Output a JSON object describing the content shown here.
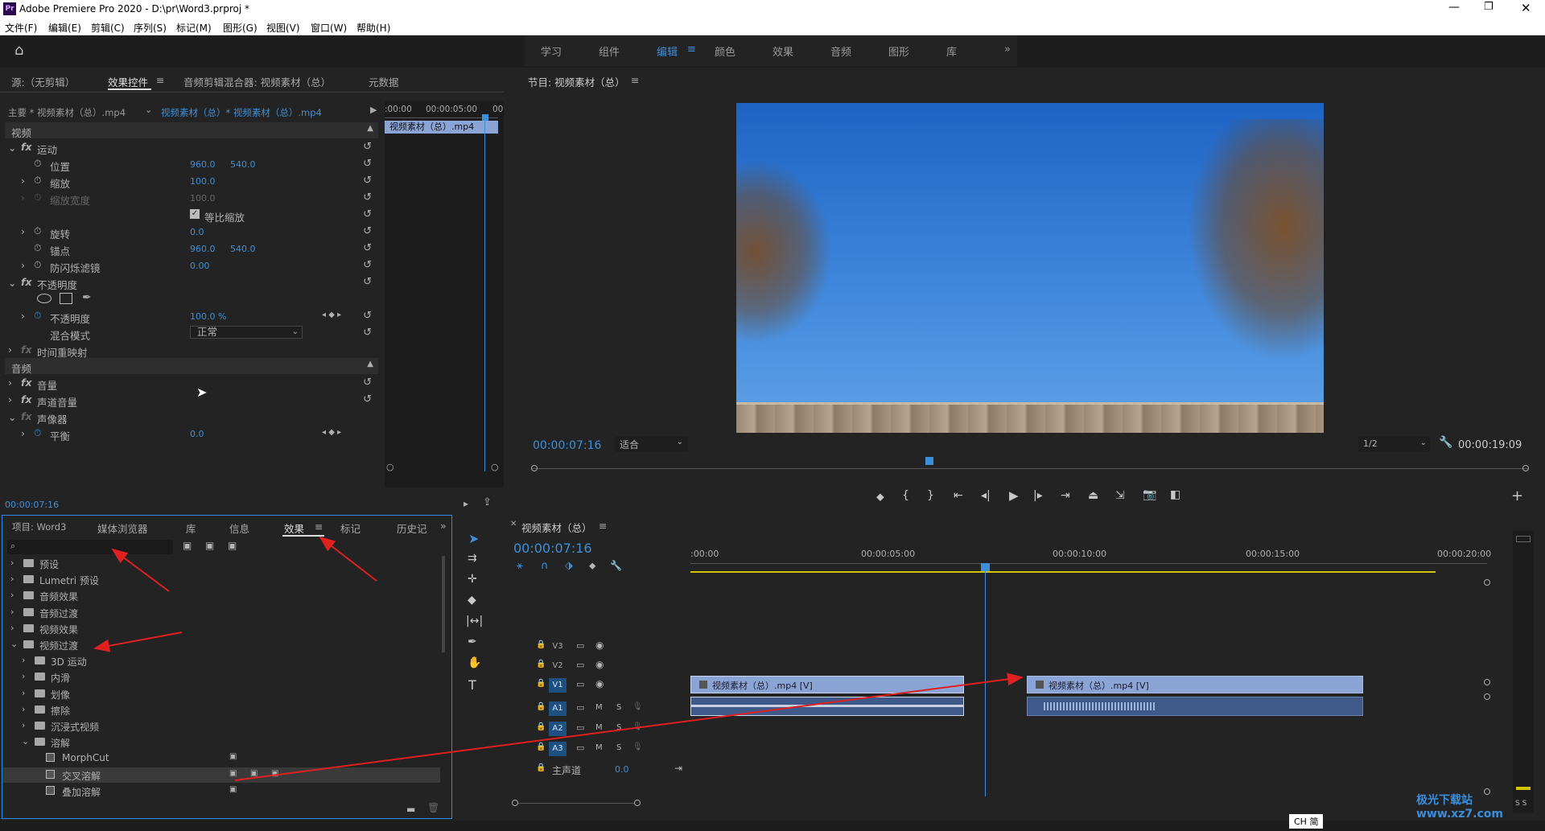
{
  "app": {
    "title": "Adobe Premiere Pro 2020 - D:\\pr\\Word3.prproj *",
    "logo": "Pr"
  },
  "menu": [
    "文件(F)",
    "编辑(E)",
    "剪辑(C)",
    "序列(S)",
    "标记(M)",
    "图形(G)",
    "视图(V)",
    "窗口(W)",
    "帮助(H)"
  ],
  "workspaces": [
    "学习",
    "组件",
    "编辑",
    "颜色",
    "效果",
    "音频",
    "图形",
    "库"
  ],
  "active_workspace": "编辑",
  "source_panel": {
    "tabs": [
      "源:（无剪辑）",
      "效果控件",
      "音频剪辑混合器: 视频素材（总）",
      "元数据"
    ],
    "master_clip": "主要 * 视频素材（总）.mp4",
    "sequence_clip": "视频素材（总）* 视频素材（总）.mp4",
    "ruler_start": ":00:00",
    "ruler_mid": "00:00:05:00",
    "ruler_end": "00",
    "clip_bar_label": "视频素材（总）.mp4",
    "video_header": "视频",
    "audio_header": "音频",
    "motion": "运动",
    "position_label": "位置",
    "position_x": "960.0",
    "position_y": "540.0",
    "scale_label": "缩放",
    "scale_value": "100.0",
    "scale_width_label": "缩放宽度",
    "scale_width_value": "100.0",
    "uniform_scale_label": "等比缩放",
    "rotation_label": "旋转",
    "rotation_value": "0.0",
    "anchor_label": "锚点",
    "anchor_x": "960.0",
    "anchor_y": "540.0",
    "antiflicker_label": "防闪烁滤镜",
    "antiflicker_value": "0.00",
    "opacity_group": "不透明度",
    "opacity_label": "不透明度",
    "opacity_value": "100.0 %",
    "blend_label": "混合模式",
    "blend_value": "正常",
    "time_remap": "时间重映射",
    "volume": "音量",
    "channel_volume": "声道音量",
    "panner": "声像器",
    "balance_label": "平衡",
    "balance_value": "0.0",
    "timecode": "00:00:07:16"
  },
  "program_monitor": {
    "title": "节目: 视频素材（总）",
    "timecode": "00:00:07:16",
    "fit": "适合",
    "resolution": "1/2",
    "duration": "00:00:19:09"
  },
  "project_panel": {
    "tabs": [
      "项目: Word3",
      "媒体浏览器",
      "库",
      "信息",
      "效果",
      "标记",
      "历史记"
    ],
    "active_tab": "效果",
    "search_placeholder": "",
    "tree": [
      {
        "label": "预设",
        "level": 0,
        "open": false
      },
      {
        "label": "Lumetri 预设",
        "level": 0,
        "open": false
      },
      {
        "label": "音频效果",
        "level": 0,
        "open": false
      },
      {
        "label": "音频过渡",
        "level": 0,
        "open": false
      },
      {
        "label": "视频效果",
        "level": 0,
        "open": false
      },
      {
        "label": "视频过渡",
        "level": 0,
        "open": true
      },
      {
        "label": "3D 运动",
        "level": 1,
        "open": false
      },
      {
        "label": "内滑",
        "level": 1,
        "open": false
      },
      {
        "label": "划像",
        "level": 1,
        "open": false
      },
      {
        "label": "擦除",
        "level": 1,
        "open": false
      },
      {
        "label": "沉浸式视频",
        "level": 1,
        "open": false
      },
      {
        "label": "溶解",
        "level": 1,
        "open": true
      },
      {
        "label": "MorphCut",
        "level": 2,
        "item": true
      },
      {
        "label": "交叉溶解",
        "level": 2,
        "item": true,
        "selected": true
      },
      {
        "label": "叠加溶解",
        "level": 2,
        "item": true
      }
    ]
  },
  "timeline": {
    "title": "视频素材（总）",
    "timecode": "00:00:07:16",
    "ruler": [
      ":00:00",
      "00:00:05:00",
      "00:00:10:00",
      "00:00:15:00",
      "00:00:20:00"
    ],
    "tracks": [
      "V3",
      "V2",
      "V1",
      "A1",
      "A2",
      "A3"
    ],
    "master_label": "主声道",
    "master_value": "0.0",
    "clip1": "视频素材（总）.mp4 [V]",
    "clip2": "视频素材（总）.mp4 [V]"
  },
  "statusbar": {
    "ime": "CH 简"
  },
  "watermark": "极光下载站 www.xz7.com",
  "colors": {
    "accent": "#3d8fdb",
    "clip": "#8aa4d6",
    "audio_clip": "#3f5a8a"
  }
}
